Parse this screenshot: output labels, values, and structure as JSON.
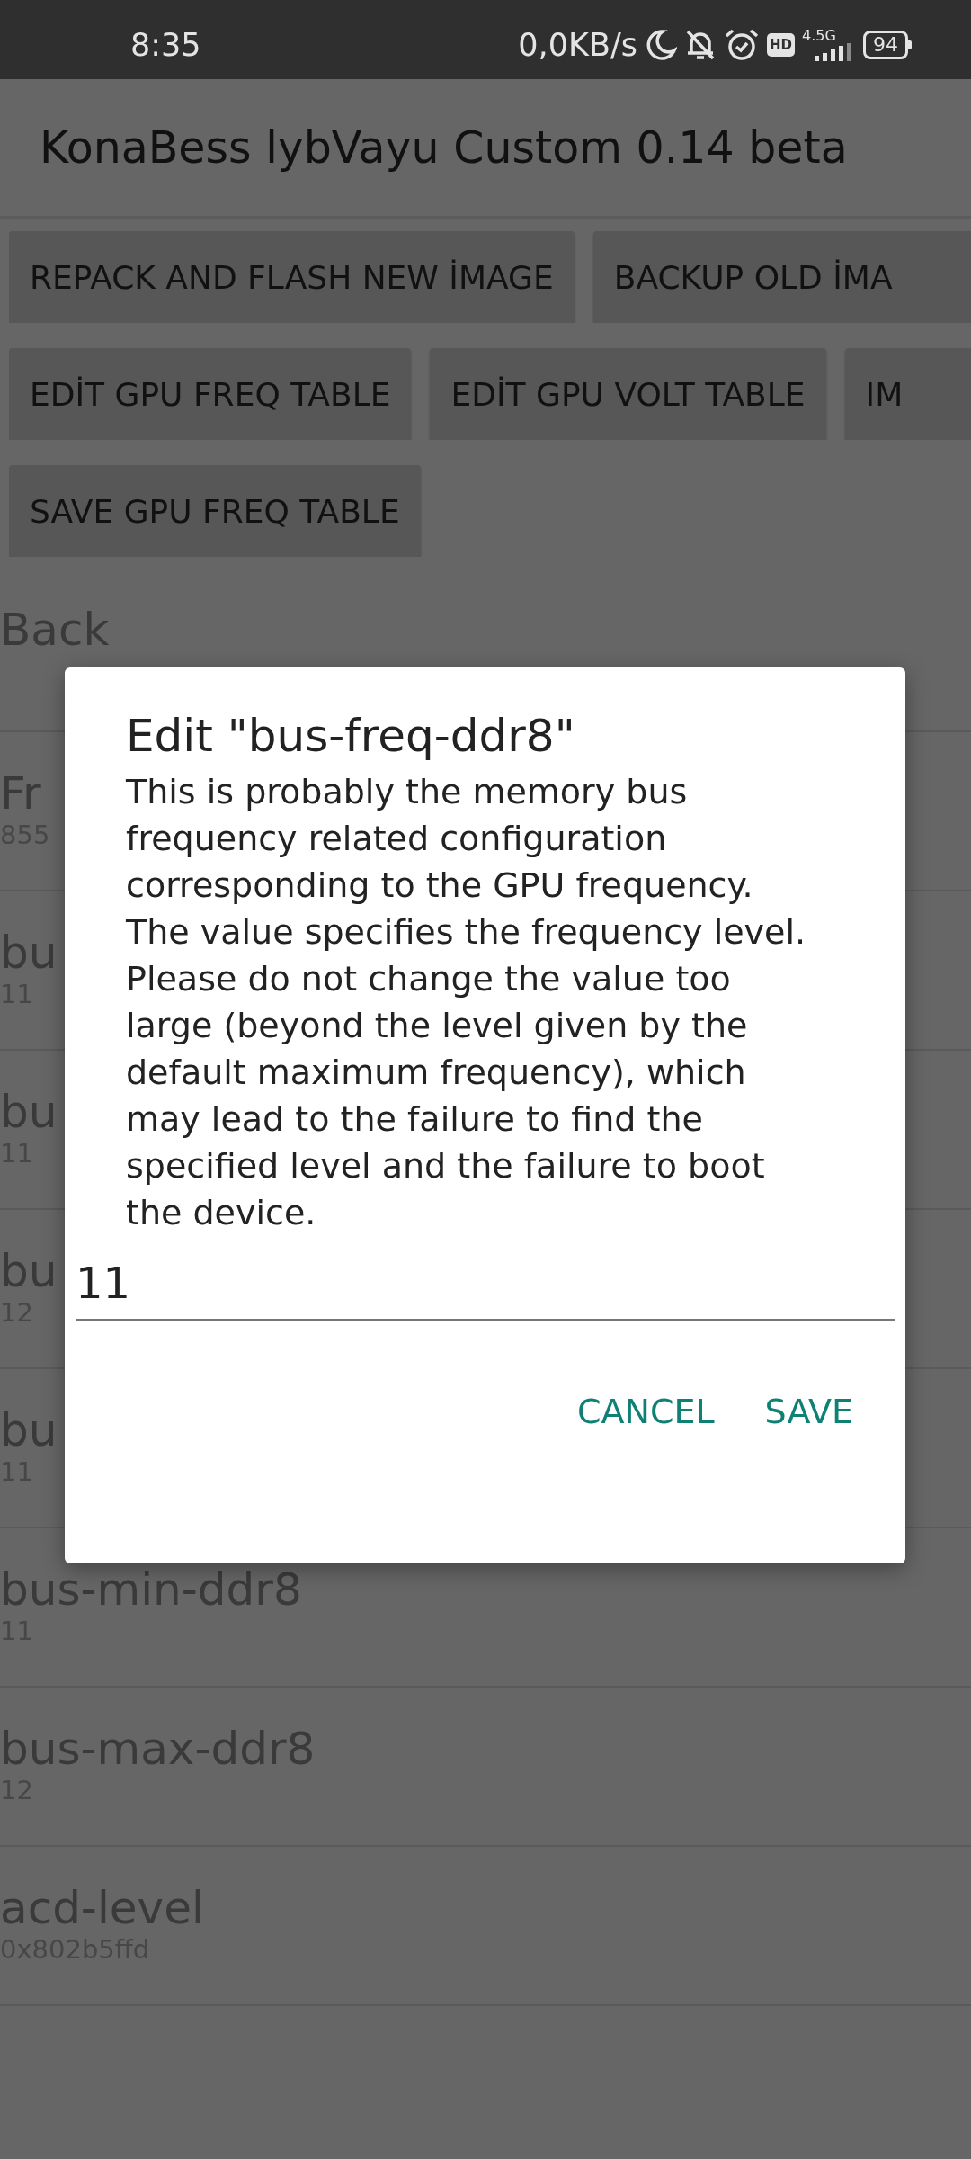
{
  "status_bar": {
    "time": "8:35",
    "net_speed": "0,0KB/s",
    "hd_badge": "HD",
    "network_type": "4.5G",
    "battery": "94"
  },
  "app_bar": {
    "title": "KonaBess lybVayu Custom 0.14 beta"
  },
  "button_rows": [
    [
      "REPACK AND FLASH NEW İMAGE",
      "BACKUP OLD İMA"
    ],
    [
      "EDİT GPU FREQ TABLE",
      "EDİT GPU VOLT TABLE",
      "IM"
    ],
    [
      "SAVE GPU FREQ TABLE"
    ]
  ],
  "back": "Back",
  "items": [
    {
      "name": "Fr",
      "value": "855"
    },
    {
      "name": "bu",
      "value": "11"
    },
    {
      "name": "bu",
      "value": "11"
    },
    {
      "name": "bu",
      "value": "12"
    },
    {
      "name": "bu",
      "value": "11"
    },
    {
      "name": "bus-min-ddr8",
      "value": "11"
    },
    {
      "name": "bus-max-ddr8",
      "value": "12"
    },
    {
      "name": "acd-level",
      "value": "0x802b5ffd"
    }
  ],
  "dialog": {
    "title": "Edit \"bus-freq-ddr8\"",
    "message": "This is probably the memory bus frequency related configuration corresponding to the GPU frequency. The value specifies the frequency level.\nPlease do not change the value too large (beyond the level given by the default maximum frequency), which may lead to the failure to find the specified level and the failure to boot the device.",
    "value": "11",
    "buttons": [
      "CANCEL",
      "SAVE"
    ]
  }
}
